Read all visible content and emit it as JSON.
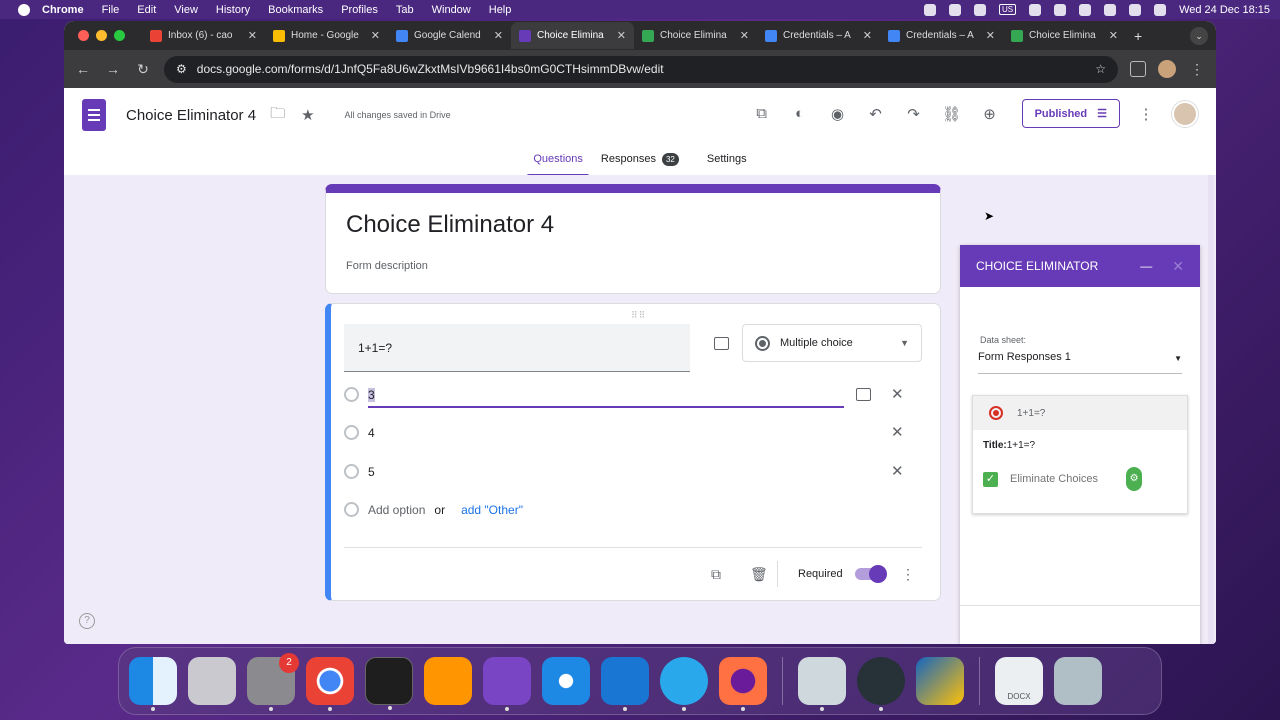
{
  "menubar": {
    "app": "Chrome",
    "items": [
      "File",
      "Edit",
      "View",
      "History",
      "Bookmarks",
      "Profiles",
      "Tab",
      "Window",
      "Help"
    ],
    "keyboard": "US",
    "clock": "Wed 24 Dec  18:15"
  },
  "browser": {
    "tabs": [
      {
        "title": "Inbox (6) - cao",
        "color": "#ea4335"
      },
      {
        "title": "Home - Google",
        "color": "#fbbc04"
      },
      {
        "title": "Google Calend",
        "color": "#4285f4"
      },
      {
        "title": "Choice Elimina",
        "color": "#673ab7"
      },
      {
        "title": "Choice Elimina",
        "color": "#34a853"
      },
      {
        "title": "Credentials – A",
        "color": "#4285f4"
      },
      {
        "title": "Credentials – A",
        "color": "#4285f4"
      },
      {
        "title": "Choice Elimina",
        "color": "#34a853"
      }
    ],
    "url": "docs.google.com/forms/d/1JnfQ5Fa8U6wZkxtMsIVb9661I4bs0mG0CTHsimmDBvw/edit"
  },
  "forms": {
    "doc_title": "Choice Eliminator 4",
    "saved_status": "All changes saved in Drive",
    "publish_label": "Published",
    "tabs": {
      "questions": "Questions",
      "responses": "Responses",
      "responses_count": "32",
      "settings": "Settings"
    },
    "form_title": "Choice Eliminator 4",
    "form_description": "Form description",
    "question": {
      "text": "1+1=?",
      "type": "Multiple choice",
      "options": [
        "3",
        "4",
        "5"
      ],
      "add_option": "Add option",
      "or_label": "or",
      "add_other": "add \"Other\"",
      "required_label": "Required"
    }
  },
  "addon": {
    "title": "CHOICE ELIMINATOR",
    "data_sheet_label": "Data sheet:",
    "data_sheet_value": "Form Responses 1",
    "question_label": "1+1=?",
    "title_prefix": "Title:",
    "title_value": "1+1=?",
    "eliminate_label": "Eliminate Choices"
  },
  "dock": {
    "apps": [
      "Finder",
      "Launchpad",
      "System Settings",
      "Chrome",
      "Terminal",
      "Books",
      "GitHub Desktop",
      "Safari",
      "VS Code",
      "Telegram",
      "Firefox",
      "Preview",
      "OBS",
      "Reeder",
      "DOCX",
      "Trash"
    ],
    "settings_badge": "2",
    "docx_label": "DOCX"
  }
}
